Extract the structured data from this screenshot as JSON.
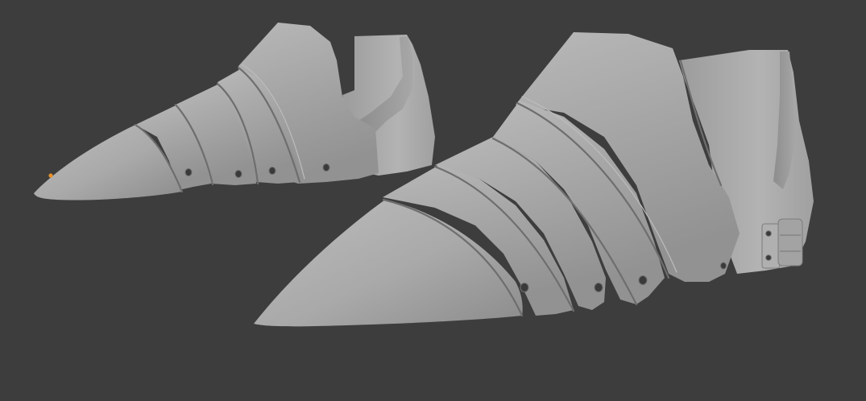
{
  "viewport": {
    "background_color": "#3d3d3d",
    "model_color": "#a5a5a5",
    "origin_marker_color": "#e8902a",
    "objects": [
      {
        "kind": "sabaton",
        "side": "back",
        "hole_count": 4
      },
      {
        "kind": "sabaton",
        "side": "front",
        "hole_count": 3,
        "has_hinge": true
      }
    ]
  }
}
